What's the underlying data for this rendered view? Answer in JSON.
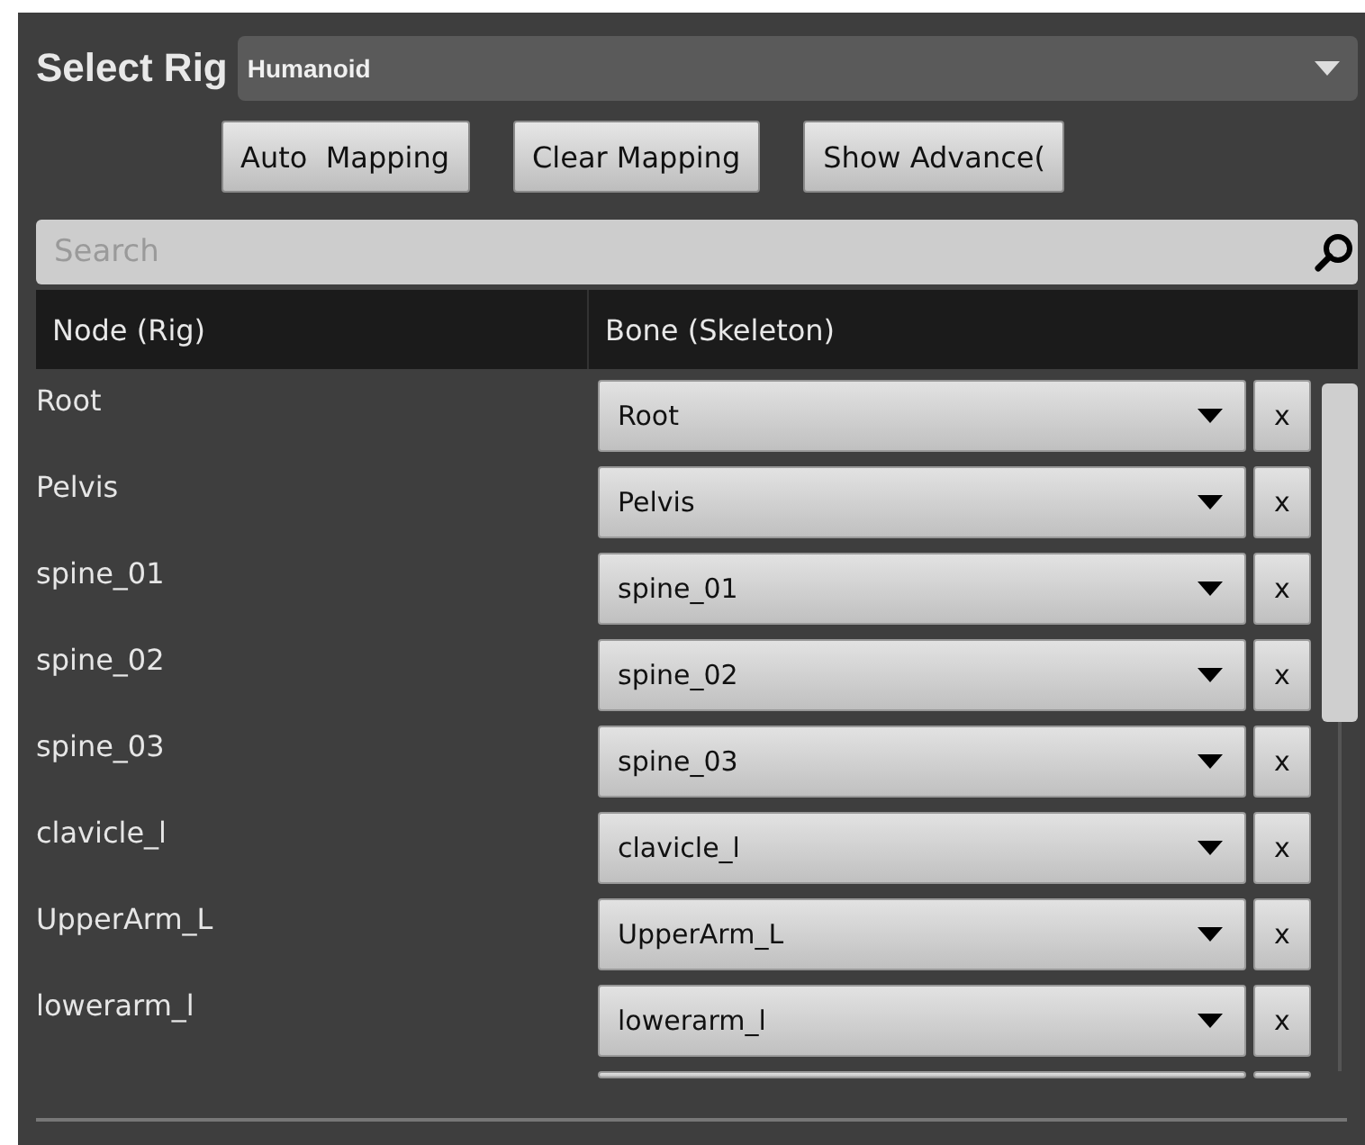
{
  "rig_selector": {
    "label": "Select Rig",
    "value": "Humanoid"
  },
  "buttons": [
    "Auto  Mapping",
    "Clear Mapping",
    "Show Advance("
  ],
  "search": {
    "placeholder": "Search"
  },
  "table": {
    "columns": [
      "Node (Rig)",
      "Bone (Skeleton)"
    ],
    "rows": [
      {
        "node": "Root",
        "bone": "Root",
        "clear": "x"
      },
      {
        "node": "Pelvis",
        "bone": "Pelvis",
        "clear": "x"
      },
      {
        "node": "spine_01",
        "bone": "spine_01",
        "clear": "x"
      },
      {
        "node": "spine_02",
        "bone": "spine_02",
        "clear": "x"
      },
      {
        "node": "spine_03",
        "bone": "spine_03",
        "clear": "x"
      },
      {
        "node": "clavicle_l",
        "bone": "clavicle_l",
        "clear": "x"
      },
      {
        "node": "UpperArm_L",
        "bone": "UpperArm_L",
        "clear": "x"
      },
      {
        "node": "lowerarm_l",
        "bone": "lowerarm_l",
        "clear": "x"
      }
    ]
  }
}
